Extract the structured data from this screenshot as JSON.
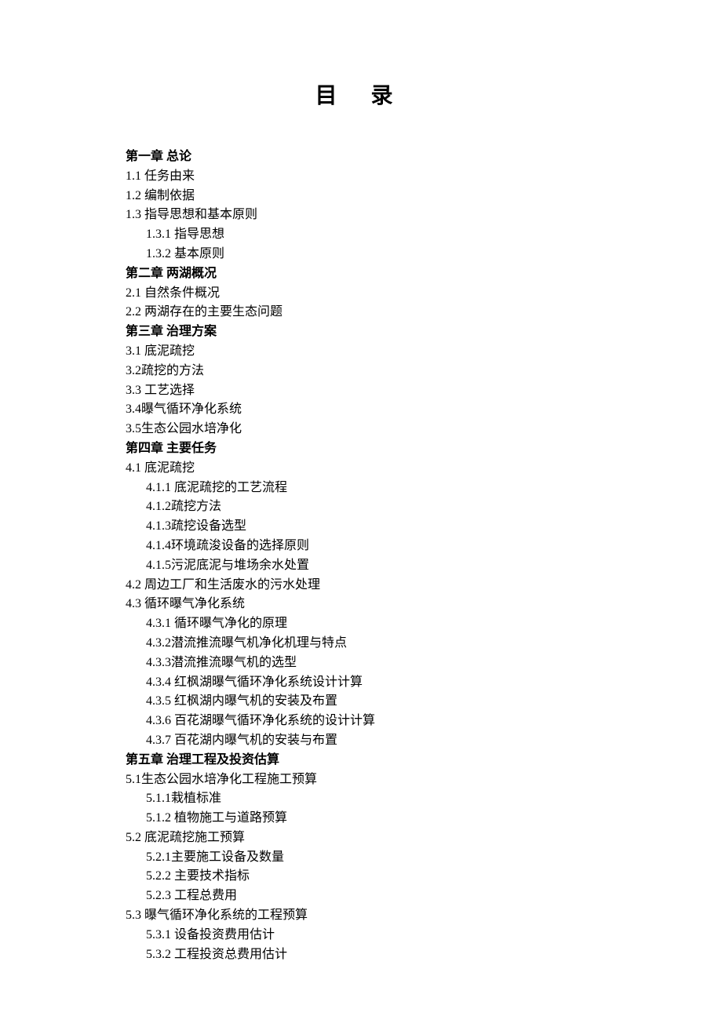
{
  "title": "目  录",
  "toc": [
    {
      "text": "第一章  总论",
      "class": "chapter level1"
    },
    {
      "text": "1.1  任务由来",
      "class": "level1"
    },
    {
      "text": "1.2  编制依据",
      "class": "level1"
    },
    {
      "text": "1.3  指导思想和基本原则",
      "class": "level1"
    },
    {
      "text": "1.3.1 指导思想",
      "class": "level2"
    },
    {
      "text": "1.3.2 基本原则",
      "class": "level2"
    },
    {
      "text": "第二章  两湖概况",
      "class": "chapter level1"
    },
    {
      "text": "2.1 自然条件概况",
      "class": "level1"
    },
    {
      "text": "2.2 两湖存在的主要生态问题",
      "class": "level1"
    },
    {
      "text": "第三章 治理方案",
      "class": "chapter level1"
    },
    {
      "text": "3.1 底泥疏挖",
      "class": "level1"
    },
    {
      "text": "3.2疏挖的方法",
      "class": "level1"
    },
    {
      "text": "3.3 工艺选择",
      "class": "level1"
    },
    {
      "text": "3.4曝气循环净化系统",
      "class": "level1"
    },
    {
      "text": "3.5生态公园水培净化",
      "class": "level1"
    },
    {
      "text": "第四章  主要任务",
      "class": "chapter level1"
    },
    {
      "text": "4.1  底泥疏挖",
      "class": "level1"
    },
    {
      "text": "4.1.1 底泥疏挖的工艺流程",
      "class": "level2"
    },
    {
      "text": "4.1.2疏挖方法",
      "class": "level2"
    },
    {
      "text": "4.1.3疏挖设备选型",
      "class": "level2"
    },
    {
      "text": "4.1.4环境疏浚设备的选择原则",
      "class": "level2"
    },
    {
      "text": "4.1.5污泥底泥与堆场余水处置",
      "class": "level2"
    },
    {
      "text": "4.2 周边工厂和生活废水的污水处理",
      "class": "level1"
    },
    {
      "text": "4.3 循环曝气净化系统",
      "class": "level1"
    },
    {
      "text": "4.3.1 循环曝气净化的原理",
      "class": "level2"
    },
    {
      "text": "4.3.2潜流推流曝气机净化机理与特点",
      "class": "level2"
    },
    {
      "text": "4.3.3潜流推流曝气机的选型",
      "class": "level2"
    },
    {
      "text": "4.3.4 红枫湖曝气循环净化系统设计计算",
      "class": "level2"
    },
    {
      "text": "4.3.5 红枫湖内曝气机的安装及布置",
      "class": "level2"
    },
    {
      "text": "4.3.6 百花湖曝气循环净化系统的设计计算",
      "class": "level2"
    },
    {
      "text": "4.3.7 百花湖内曝气机的安装与布置",
      "class": "level2"
    },
    {
      "text": "第五章  治理工程及投资估算",
      "class": "chapter level1"
    },
    {
      "text": "5.1生态公园水培净化工程施工预算",
      "class": "level1"
    },
    {
      "text": "5.1.1栽植标准",
      "class": "level2"
    },
    {
      "text": "5.1.2 植物施工与道路预算",
      "class": "level2"
    },
    {
      "text": "5.2 底泥疏挖施工预算",
      "class": "level1"
    },
    {
      "text": "5.2.1主要施工设备及数量",
      "class": "level2"
    },
    {
      "text": "5.2.2 主要技术指标",
      "class": "level2"
    },
    {
      "text": "5.2.3 工程总费用",
      "class": "level2"
    },
    {
      "text": "5.3 曝气循环净化系统的工程预算",
      "class": "level1"
    },
    {
      "text": "5.3.1 设备投资费用估计",
      "class": "level2"
    },
    {
      "text": "5.3.2 工程投资总费用估计",
      "class": "level2"
    }
  ]
}
